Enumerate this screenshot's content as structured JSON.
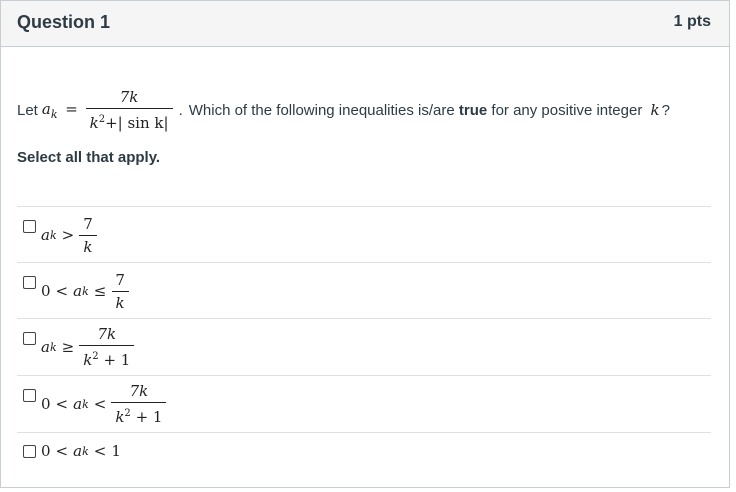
{
  "question": {
    "title": "Question 1",
    "points": "1 pts"
  },
  "prompt": {
    "lead": "Let",
    "lhs": "a",
    "lhs_sub": "k",
    "eq": "=",
    "num": "7k",
    "den_k": "k",
    "den_sup": "2",
    "den_rest": "+| sin k|",
    "dot": ".",
    "tail_before": "Which of the following inequalities is/are",
    "tail_bold": "true",
    "tail_after": "for any positive integer",
    "var_k": "k",
    "qmark": "?"
  },
  "instruction": "Select all that apply.",
  "answers": {
    "opt1": {
      "a": "a",
      "sub": "k",
      "rel": ">",
      "num": "7",
      "den": "k"
    },
    "opt2": {
      "zero": "0",
      "rel1": "<",
      "a": "a",
      "sub": "k",
      "rel2": "≤",
      "num": "7",
      "den": "k"
    },
    "opt3": {
      "a": "a",
      "sub": "k",
      "rel": "≥",
      "num": "7k",
      "den_k": "k",
      "den_sup": "2",
      "den_rest": "+ 1"
    },
    "opt4": {
      "zero": "0",
      "rel1": "<",
      "a": "a",
      "sub": "k",
      "rel2": "<",
      "num": "7k",
      "den_k": "k",
      "den_sup": "2",
      "den_rest": "+ 1"
    },
    "opt5": {
      "zero": "0",
      "rel1": "<",
      "a": "a",
      "sub": "k",
      "rel2": "<",
      "one": "1"
    }
  }
}
